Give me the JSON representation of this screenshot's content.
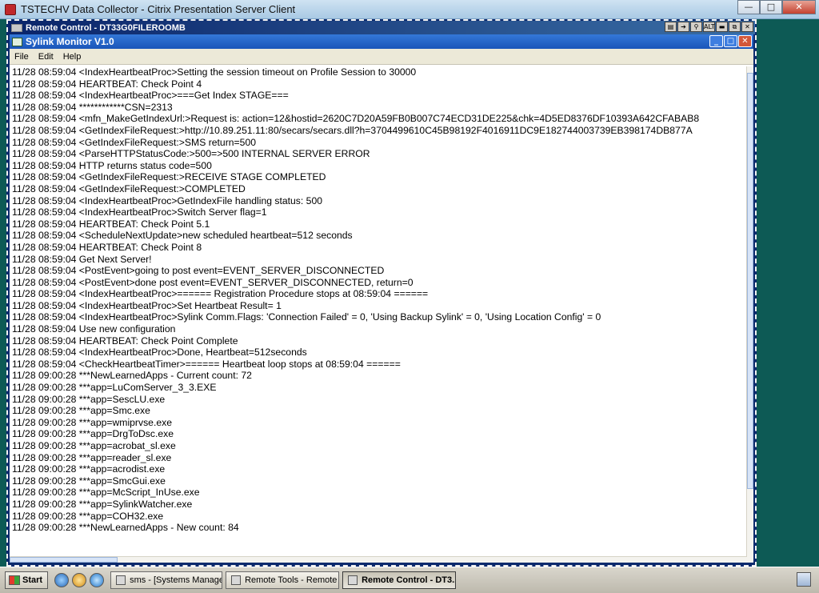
{
  "outer_window": {
    "title": "TSTECHV Data Collector - Citrix Presentation Server Client",
    "controls": {
      "minimize": "—",
      "maximize": "□",
      "close": "✕"
    }
  },
  "remote_control": {
    "title": "Remote Control - DT33G0FILEROOMB",
    "tools": [
      "▤",
      "➔",
      "⚲",
      "ALT",
      "▬",
      "⧉",
      "✕"
    ]
  },
  "sylink": {
    "title": "Sylink Monitor V1.0",
    "controls": {
      "minimize": "_",
      "maximize": "□",
      "close": "✕"
    },
    "menu": [
      "File",
      "Edit",
      "Help"
    ],
    "log_lines": [
      "11/28 08:59:04 <IndexHeartbeatProc>Setting the session timeout on Profile Session to 30000",
      "11/28 08:59:04 HEARTBEAT: Check Point 4",
      "11/28 08:59:04 <IndexHeartbeatProc>===Get Index STAGE===",
      "11/28 08:59:04 ************CSN=2313",
      "11/28 08:59:04 <mfn_MakeGetIndexUrl:>Request is: action=12&hostid=2620C7D20A59FB0B007C74ECD31DE225&chk=4D5ED8376DF10393A642CFABAB8",
      "11/28 08:59:04 <GetIndexFileRequest:>http://10.89.251.11:80/secars/secars.dll?h=3704499610C45B98192F4016911DC9E182744003739EB398174DB877A",
      "11/28 08:59:04 <GetIndexFileRequest:>SMS return=500",
      "11/28 08:59:04 <ParseHTTPStatusCode:>500=>500 INTERNAL SERVER ERROR",
      "11/28 08:59:04 HTTP returns status code=500",
      "11/28 08:59:04 <GetIndexFileRequest:>RECEIVE STAGE COMPLETED",
      "11/28 08:59:04 <GetIndexFileRequest:>COMPLETED",
      "11/28 08:59:04 <IndexHeartbeatProc>GetIndexFile handling status: 500",
      "11/28 08:59:04 <IndexHeartbeatProc>Switch Server flag=1",
      "11/28 08:59:04 HEARTBEAT: Check Point 5.1",
      "11/28 08:59:04 <ScheduleNextUpdate>new scheduled heartbeat=512 seconds",
      "11/28 08:59:04 HEARTBEAT: Check Point 8",
      "11/28 08:59:04 Get Next Server!",
      "11/28 08:59:04 <PostEvent>going to post event=EVENT_SERVER_DISCONNECTED",
      "11/28 08:59:04 <PostEvent>done post event=EVENT_SERVER_DISCONNECTED, return=0",
      "11/28 08:59:04 <IndexHeartbeatProc>====== Registration Procedure stops at 08:59:04 ======",
      "11/28 08:59:04 <IndexHeartbeatProc>Set Heartbeat Result= 1",
      "11/28 08:59:04 <IndexHeartbeatProc>Sylink Comm.Flags: 'Connection Failed' = 0, 'Using Backup Sylink' = 0, 'Using Location Config' = 0",
      "11/28 08:59:04 Use new configuration",
      "11/28 08:59:04 HEARTBEAT: Check Point Complete",
      "11/28 08:59:04 <IndexHeartbeatProc>Done, Heartbeat=512seconds",
      "11/28 08:59:04 <CheckHeartbeatTimer>====== Heartbeat loop stops at 08:59:04 ======",
      "11/28 09:00:28 ***NewLearnedApps - Current count: 72",
      "11/28 09:00:28 ***app=LuComServer_3_3.EXE",
      "11/28 09:00:28 ***app=SescLU.exe",
      "11/28 09:00:28 ***app=Smc.exe",
      "11/28 09:00:28 ***app=wmiprvse.exe",
      "11/28 09:00:28 ***app=DrgToDsc.exe",
      "11/28 09:00:28 ***app=acrobat_sl.exe",
      "11/28 09:00:28 ***app=reader_sl.exe",
      "11/28 09:00:28 ***app=acrodist.exe",
      "11/28 09:00:28 ***app=SmcGui.exe",
      "11/28 09:00:28 ***app=McScript_InUse.exe",
      "11/28 09:00:28 ***app=SylinkWatcher.exe",
      "11/28 09:00:28 ***app=COH32.exe",
      "11/28 09:00:28 ***NewLearnedApps - New count: 84"
    ]
  },
  "taskbar": {
    "start_label": "Start",
    "tasks": [
      {
        "label": "sms - [Systems Manage...",
        "active": false
      },
      {
        "label": "Remote Tools - Remote ...",
        "active": false
      },
      {
        "label": "Remote Control - DT3...",
        "active": true
      }
    ]
  }
}
